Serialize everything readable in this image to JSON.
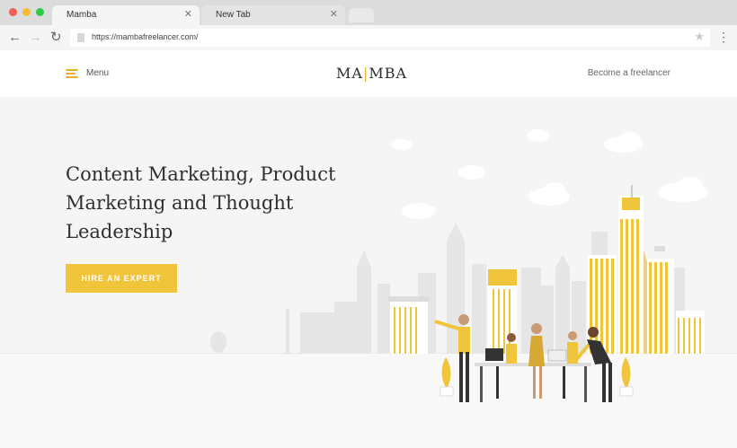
{
  "browser": {
    "tabs": [
      {
        "label": "Mamba",
        "active": true
      },
      {
        "label": "New Tab",
        "active": false
      }
    ],
    "url": "https://mambafreelancer.com/",
    "traffic_colors": [
      "#ee5f57",
      "#f6be2f",
      "#2ecb48"
    ]
  },
  "header": {
    "menu_label": "Menu",
    "logo_left": "MA",
    "logo_sep": "|",
    "logo_right": "MBA",
    "become_label": "Become a freelancer"
  },
  "hero": {
    "headline": "Content Marketing, Product Marketing and Thought Leadership",
    "cta_label": "HIRE AN EXPERT"
  },
  "colors": {
    "accent": "#f0c43b",
    "skyline": "#e3e3e3",
    "text": "#2f2f2f"
  }
}
